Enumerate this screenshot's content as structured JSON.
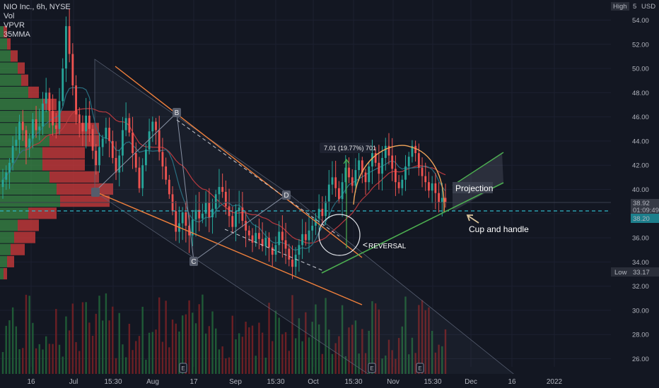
{
  "legend": {
    "symbol": "NIO Inc., 6h, NYSE",
    "ind1": "Vol",
    "ind2": "VPVR",
    "ind3": "35MMA"
  },
  "price_scale": {
    "currency": "USD",
    "high_tag": "High",
    "high_tag_value": "5",
    "low_tag": "Low",
    "low_value": "33.17",
    "last_price": "38.92",
    "countdown": "01:09:49",
    "hline_value": "38.20"
  },
  "colors": {
    "bg": "#131722",
    "up": "#26a69a",
    "down": "#ef5350",
    "vol_up": "#1f5a36",
    "vol_down": "#6b1f24",
    "vpvr_up": "#3a8a45",
    "vpvr_down": "#c8393b",
    "orange": "#f0803c",
    "green_line": "#4caf50",
    "hline": "#2fb7c7",
    "ma_red": "#b83a3f",
    "ma_blue": "#2a6f80"
  },
  "annotations": {
    "measure": "7.01 (19.77%) 701",
    "reversal": "REVERSAL",
    "projection": "Projection",
    "cup": "Cup and handle",
    "points": [
      "B",
      "C",
      "D"
    ],
    "earnings": "E"
  },
  "chart_data": {
    "type": "candlestick",
    "title": "NIO Inc., 6h, NYSE",
    "y_axis": {
      "ticks": [
        "26.00",
        "28.00",
        "30.00",
        "32.00",
        "34.00",
        "36.00",
        "38.00",
        "40.00",
        "42.00",
        "44.00",
        "46.00",
        "48.00",
        "50.00",
        "52.00",
        "54.00"
      ],
      "range": [
        25.0,
        56.0
      ]
    },
    "x_axis": {
      "ticks": [
        "16",
        "Jul",
        "15:30",
        "Aug",
        "17",
        "Sep",
        "15:30",
        "Oct",
        "15:30",
        "Nov",
        "15:30",
        "Dec",
        "16",
        "2022"
      ]
    },
    "ohlc_closes": [
      40.8,
      41.4,
      42.2,
      43.6,
      44.1,
      45.6,
      44.9,
      43.5,
      44.2,
      45.8,
      44.9,
      45.2,
      47.1,
      48.0,
      46.5,
      45.3,
      45.0,
      47.3,
      50.0,
      53.5,
      51.2,
      48.6,
      46.2,
      45.5,
      44.8,
      46.1,
      45.0,
      43.2,
      42.0,
      43.5,
      44.2,
      45.1,
      44.0,
      42.6,
      41.4,
      42.8,
      44.9,
      45.9,
      44.7,
      43.0,
      41.8,
      40.1,
      42.0,
      43.3,
      44.8,
      45.6,
      44.9,
      43.1,
      41.9,
      40.8,
      39.6,
      38.2,
      36.5,
      37.2,
      38.1,
      37.0,
      36.2,
      37.5,
      38.3,
      37.6,
      38.0,
      38.9,
      37.7,
      38.4,
      39.6,
      40.2,
      39.8,
      38.6,
      37.8,
      36.9,
      38.2,
      38.5,
      37.4,
      36.6,
      36.2,
      35.6,
      36.4,
      35.9,
      35.3,
      36.0,
      35.2,
      34.6,
      35.4,
      36.5,
      35.8,
      35.1,
      34.2,
      33.6,
      34.6,
      35.4,
      36.3,
      35.8,
      36.6,
      37.0,
      37.6,
      38.4,
      37.8,
      39.0,
      40.4,
      41.0,
      40.1,
      39.2,
      40.6,
      41.8,
      41.0,
      40.3,
      41.6,
      42.4,
      41.4,
      40.6,
      41.9,
      43.0,
      42.2,
      41.3,
      42.6,
      43.6,
      42.8,
      41.7,
      40.6,
      40.1,
      40.8,
      41.9,
      42.7,
      43.6,
      43.0,
      41.8,
      41.1,
      40.6,
      39.9,
      40.5,
      39.7,
      38.9,
      39.3,
      38.92
    ],
    "volume_profile": {
      "levels": [
        53,
        52,
        51,
        50,
        49,
        48,
        47,
        46,
        45,
        44,
        43,
        42,
        41,
        40,
        39,
        38,
        37,
        36,
        35,
        34,
        33
      ],
      "up_widths": [
        5,
        10,
        15,
        25,
        30,
        40,
        60,
        70,
        80,
        70,
        60,
        60,
        70,
        80,
        85,
        40,
        25,
        20,
        15,
        10,
        5
      ],
      "down_widths": [
        5,
        5,
        10,
        10,
        10,
        15,
        20,
        40,
        60,
        70,
        60,
        60,
        70,
        80,
        70,
        40,
        30,
        30,
        20,
        10,
        5
      ]
    },
    "moving_average": "35MMA",
    "horizontal_line": 38.2,
    "last_price": 38.92,
    "low": 33.17
  }
}
